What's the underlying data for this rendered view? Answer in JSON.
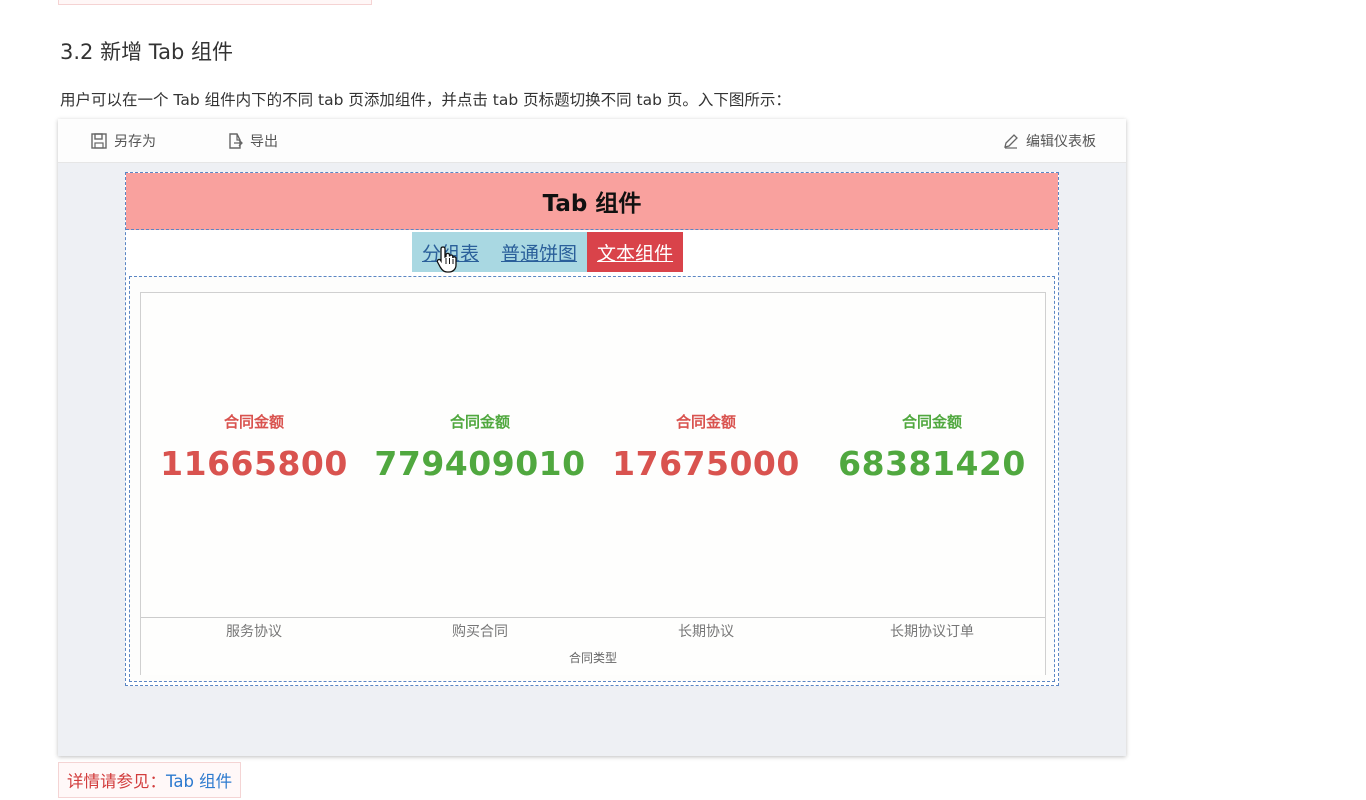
{
  "heading": "3.2 新增 Tab 组件",
  "intro": "用户可以在一个 Tab 组件内下的不同 tab 页添加组件，并点击 tab 页标题切换不同 tab 页。入下图所示：",
  "toolbar": {
    "save_as": "另存为",
    "export": "导出",
    "edit_dashboard": "编辑仪表板"
  },
  "dashboard": {
    "title": "Tab 组件",
    "tabs": [
      {
        "label": "分组表",
        "active": false
      },
      {
        "label": "普通饼图",
        "active": false
      },
      {
        "label": "文本组件",
        "active": true
      }
    ],
    "metrics": [
      {
        "label": "合同金额",
        "value": "11665800",
        "category": "服务协议",
        "color": "#d9534f"
      },
      {
        "label": "合同金额",
        "value": "779409010",
        "category": "购买合同",
        "color": "#50a83f"
      },
      {
        "label": "合同金额",
        "value": "17675000",
        "category": "长期协议",
        "color": "#d9534f"
      },
      {
        "label": "合同金额",
        "value": "68381420",
        "category": "长期协议订单",
        "color": "#50a83f"
      }
    ],
    "axis_title": "合同类型"
  },
  "reference": {
    "prefix": "详情请参见：",
    "link": "Tab 组件"
  },
  "colors": {
    "tab_header": "#f9a19e",
    "tab_inactive": "#a9d8e2",
    "tab_active": "#d9434a",
    "metric_red": "#d9534f",
    "metric_green": "#50a83f"
  }
}
